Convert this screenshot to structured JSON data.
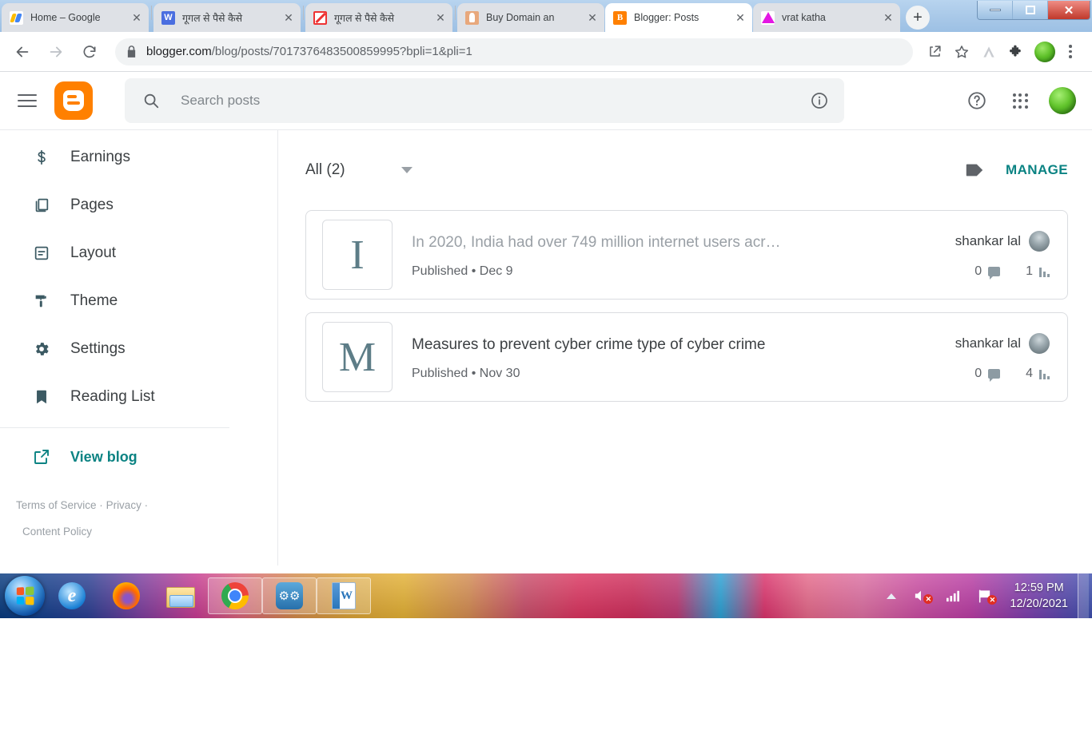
{
  "browser": {
    "tabs": [
      {
        "title": "Home – Google",
        "favicon": "adsense-icon",
        "active": false
      },
      {
        "title": "गूगल से पैसे कैसे",
        "favicon": "wordpress-icon",
        "active": false
      },
      {
        "title": "गूगल से पैसे कैसे",
        "favicon": "no-entry-icon",
        "active": false
      },
      {
        "title": "Buy Domain an",
        "favicon": "domain-icon",
        "active": false
      },
      {
        "title": "Blogger: Posts",
        "favicon": "blogger-icon",
        "active": true
      },
      {
        "title": "vrat katha",
        "favicon": "triangle-icon",
        "active": false
      }
    ],
    "new_tab_label": "+",
    "close_label": "✕",
    "window_controls": {
      "minimize": "minimize-icon",
      "maximize": "maximize-icon",
      "close": "✕"
    },
    "toolbar": {
      "back": "back-arrow-icon",
      "forward": "forward-arrow-icon",
      "reload": "reload-icon",
      "lock": "lock-icon",
      "url_domain": "blogger.com",
      "url_path": "/blog/posts/7017376483500859995?bpli=1&pli=1",
      "share": "share-icon",
      "bookmark": "star-icon",
      "brave": "extension-a-icon",
      "extensions": "puzzle-icon",
      "profile": "profile-avatar",
      "menu": "three-dot-menu-icon"
    }
  },
  "app": {
    "menu_label": "menu-icon",
    "logo_label": "blogger-logo",
    "search": {
      "placeholder": "Search posts",
      "value": "",
      "icon": "search-icon"
    },
    "info_icon": "info-icon",
    "help_icon": "help-icon",
    "apps_icon": "apps-grid-icon",
    "account_avatar": "account-avatar"
  },
  "sidebar": {
    "items": [
      {
        "label": "Earnings",
        "icon": "dollar-icon"
      },
      {
        "label": "Pages",
        "icon": "pages-icon"
      },
      {
        "label": "Layout",
        "icon": "layout-icon"
      },
      {
        "label": "Theme",
        "icon": "theme-brush-icon"
      },
      {
        "label": "Settings",
        "icon": "gear-icon"
      },
      {
        "label": "Reading List",
        "icon": "bookmark-icon"
      }
    ],
    "view_blog": {
      "label": "View blog",
      "icon": "external-link-icon"
    },
    "legal": {
      "terms": "Terms of Service",
      "sep1": "·",
      "privacy": "Privacy",
      "sep2": "·",
      "content_policy": "Content Policy"
    }
  },
  "main": {
    "filter": {
      "label": "All (2)",
      "caret": "chevron-down-icon"
    },
    "label_icon": "label-tag-icon",
    "manage_label": "MANAGE",
    "posts": [
      {
        "initial": "I",
        "title": "In 2020, India had over 749 million internet users acr…",
        "title_muted": true,
        "status": "Published • Dec 9",
        "author": "shankar lal",
        "comments": "0",
        "views": "1"
      },
      {
        "initial": "M",
        "title": "Measures to prevent cyber crime type of cyber crime",
        "title_muted": false,
        "status": "Published • Nov 30",
        "author": "shankar lal",
        "comments": "0",
        "views": "4"
      }
    ]
  },
  "taskbar": {
    "start": "windows-start-orb",
    "items": [
      {
        "name": "internet-explorer-icon",
        "pinned": false
      },
      {
        "name": "firefox-icon",
        "pinned": false
      },
      {
        "name": "file-explorer-icon",
        "pinned": false
      },
      {
        "name": "chrome-icon",
        "pinned": true
      },
      {
        "name": "gears-app-icon",
        "pinned": true
      },
      {
        "name": "word-icon",
        "pinned": true
      }
    ],
    "tray": {
      "arrow": "show-hidden-icons-icon",
      "volume": "volume-muted-icon",
      "network": "network-signal-icon",
      "action_center": "action-center-flag-icon",
      "time": "12:59 PM",
      "date": "12/20/2021"
    }
  },
  "colors": {
    "blogger_orange": "#ff8000",
    "teal_accent": "#0b8383",
    "text_primary": "#3c4043",
    "text_secondary": "#5f6368",
    "text_muted": "#9aa0a6",
    "border": "#dadce0"
  }
}
